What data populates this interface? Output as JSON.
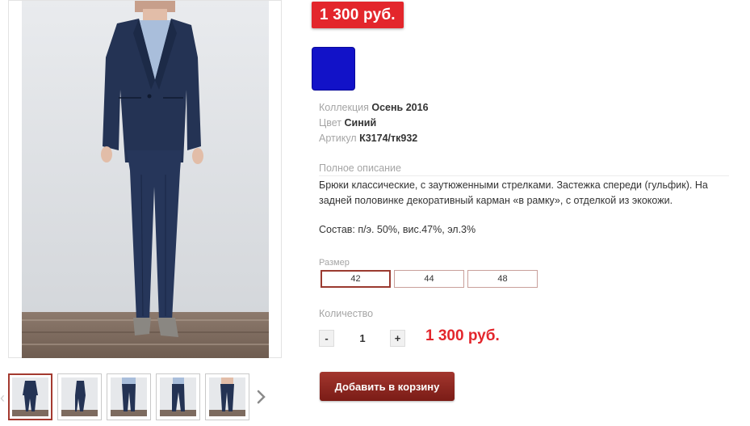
{
  "product": {
    "price_badge": "1 300 руб.",
    "color_swatch": "#1212c8",
    "specs": [
      {
        "label": "Коллекция",
        "value": "Осень 2016"
      },
      {
        "label": "Цвет",
        "value": "Синий"
      },
      {
        "label": "Артикул",
        "value": "К3174/тк932"
      }
    ],
    "description_title": "Полное описание",
    "description": "Брюки классические, с заутюженными стрелками. Застежка спереди (гульфик). На задней половинке декоративный карман «в рамку», с отделкой из экокожи.",
    "composition": "Состав: п/э. 50%, вис.47%, эл.3%"
  },
  "size": {
    "title": "Размер",
    "options": [
      "42",
      "44",
      "48"
    ],
    "selected": "42"
  },
  "quantity": {
    "title": "Количество",
    "minus": "-",
    "value": "1",
    "plus": "+",
    "total": "1 300 руб."
  },
  "cart": {
    "add_label": "Добавить в корзину"
  },
  "gallery": {
    "thumbnails": [
      "front-suit",
      "side-suit",
      "trousers-front",
      "trousers-side",
      "trousers-back"
    ],
    "active_index": 0,
    "prev_icon": "chevron-left-icon",
    "next_icon": "chevron-right-icon"
  },
  "colors": {
    "accent_red": "#e3262c",
    "button_dark_red": "#8b2720",
    "suit_navy": "#243354"
  }
}
